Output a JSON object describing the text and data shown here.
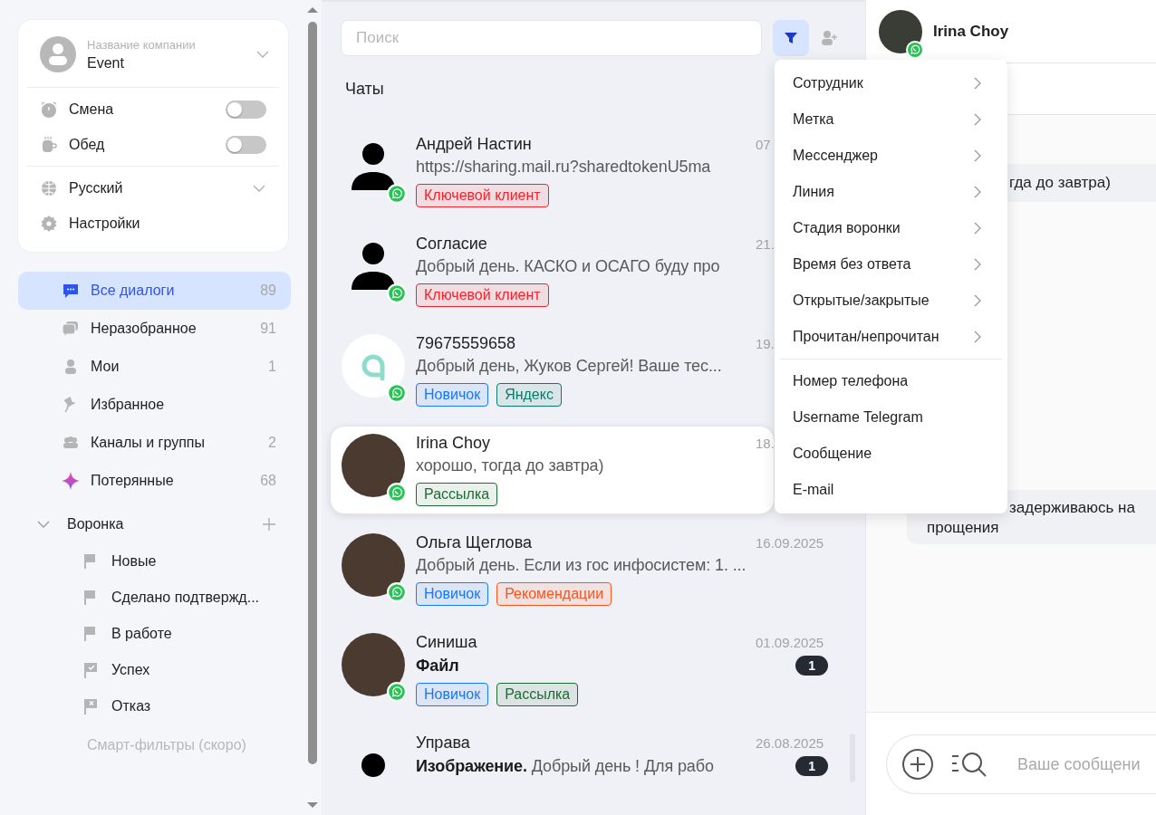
{
  "sidebar": {
    "account": {
      "company_label": "Название компании",
      "name": "Event"
    },
    "toggles": [
      {
        "label": "Смена",
        "on": false
      },
      {
        "label": "Обед",
        "on": false
      }
    ],
    "language": "Русский",
    "settings": "Настройки",
    "nav": [
      {
        "label": "Все диалоги",
        "count": "89",
        "selected": true
      },
      {
        "label": "Неразобранное",
        "count": "91",
        "selected": false
      },
      {
        "label": "Мои",
        "count": "1",
        "selected": false
      },
      {
        "label": "Избранное",
        "selected": false
      },
      {
        "label": "Каналы и группы",
        "count": "2",
        "selected": false
      },
      {
        "label": "Потерянные",
        "count": "68",
        "selected": false
      }
    ],
    "funnel": {
      "title": "Воронка",
      "expanded": true,
      "children": [
        {
          "label": "Новые",
          "kind": "flag"
        },
        {
          "label": "Сделано подтвержд...",
          "kind": "flag"
        },
        {
          "label": "В работе",
          "kind": "flag"
        },
        {
          "label": "Успех",
          "kind": "success"
        },
        {
          "label": "Отказ",
          "kind": "fail"
        }
      ]
    },
    "smart_filters": {
      "label": "Смарт-фильтры (скоро)",
      "disabled": true
    }
  },
  "chat_list": {
    "search": {
      "placeholder": "Поиск"
    },
    "filter_active": true,
    "heading": "Чаты",
    "chats": [
      {
        "name": "Андрей Настин",
        "date": "07",
        "preview": "https://sharing.mail.ru?sharedtokenU5ma",
        "avatar": {
          "kind": "silhouette"
        },
        "messenger_badge": true,
        "selected": false,
        "tags": [
          {
            "label": "Ключевой клиент",
            "color": "#f5222d"
          }
        ]
      },
      {
        "name": "Согласие",
        "date": "21.",
        "preview": "Добрый день. КАСКО и ОСАГО буду про",
        "avatar": {
          "kind": "silhouette"
        },
        "messenger_badge": true,
        "selected": false,
        "tags": [
          {
            "label": "Ключевой клиент",
            "color": "#f5222d"
          }
        ]
      },
      {
        "name": "79675559658",
        "date": "19.",
        "preview": "Добрый день, Жуков Сергей! Ваше тес...",
        "avatar": {
          "kind": "logo"
        },
        "messenger_badge": true,
        "selected": false,
        "tags": [
          {
            "label": "Новичок",
            "color": "#1677ff"
          },
          {
            "label": "Яндекс",
            "color": "#0b7a6b"
          }
        ]
      },
      {
        "name": "Irina Choy",
        "date": "18.",
        "preview": "хорошо, тогда до завтра)",
        "avatar": {
          "kind": "photo"
        },
        "messenger_badge": true,
        "selected": true,
        "tags": [
          {
            "label": "Рассылка",
            "color": "#1f6b34"
          }
        ]
      },
      {
        "name": "Ольга Щеглова",
        "date": "16.09.2025",
        "preview": "Добрый день. Если из гос инфосистем: 1. ...",
        "avatar": {
          "kind": "photo"
        },
        "messenger_badge": true,
        "selected": false,
        "tags": [
          {
            "label": "Новичок",
            "color": "#1677ff"
          },
          {
            "label": "Рекомендации",
            "color": "#fa541c"
          }
        ]
      },
      {
        "name": "Синиша",
        "date": "01.09.2025",
        "preview": "**Файл**",
        "unread": "1",
        "avatar": {
          "kind": "photo"
        },
        "messenger_badge": true,
        "selected": false,
        "tags": [
          {
            "label": "Новичок",
            "color": "#1677ff"
          },
          {
            "label": "Рассылка",
            "color": "#1f6b34"
          }
        ]
      },
      {
        "name": "Управа",
        "date": "26.08.2025",
        "preview": "**Изображение.** Добрый день ! Для рабо",
        "unread": "1",
        "avatar": {
          "kind": "dot"
        },
        "messenger_badge": false,
        "selected": false
      }
    ]
  },
  "filter_menu": {
    "items": [
      {
        "label": "Сотрудник",
        "submenu": true
      },
      {
        "label": "Метка",
        "submenu": true
      },
      {
        "label": "Мессенджер",
        "submenu": true
      },
      {
        "label": "Линия",
        "submenu": true
      },
      {
        "label": "Стадия воронки",
        "submenu": true
      },
      {
        "label": "Время без ответа",
        "submenu": true
      },
      {
        "label": "Открытые/закрытые",
        "submenu": true
      },
      {
        "label": "Прочитан/непрочитан",
        "submenu": true
      },
      {
        "label": "Номер телефона",
        "submenu": false
      },
      {
        "label": "Username Telegram",
        "submenu": false
      },
      {
        "label": "Сообщение",
        "submenu": false
      },
      {
        "label": "E-mail",
        "submenu": false
      }
    ]
  },
  "chat": {
    "contact": "Irina Choy",
    "messenger_badge": true,
    "messages": [
      {
        "fragments": [
          "гда до завтра)"
        ]
      },
      {
        "fragments": [
          "задерживаюсь на",
          "прощения"
        ]
      }
    ],
    "composer": {
      "placeholder": "Ваше сообщени"
    }
  }
}
